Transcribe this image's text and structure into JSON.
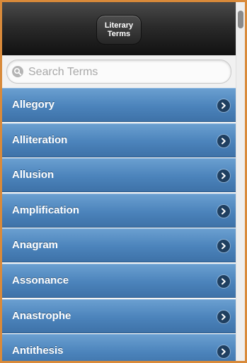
{
  "header": {
    "title": "Literary\nTerms"
  },
  "search": {
    "placeholder": "Search Terms",
    "value": ""
  },
  "list": {
    "items": [
      {
        "label": "Allegory"
      },
      {
        "label": "Alliteration"
      },
      {
        "label": "Allusion"
      },
      {
        "label": "Amplification"
      },
      {
        "label": "Anagram"
      },
      {
        "label": "Assonance"
      },
      {
        "label": "Anastrophe"
      },
      {
        "label": "Antithesis"
      }
    ],
    "item_icon": "chevron-right-icon"
  },
  "colors": {
    "header_bg": "#1e1e1e",
    "list_item_bg": "#4b83bb",
    "frame_border": "#d98a3a"
  }
}
